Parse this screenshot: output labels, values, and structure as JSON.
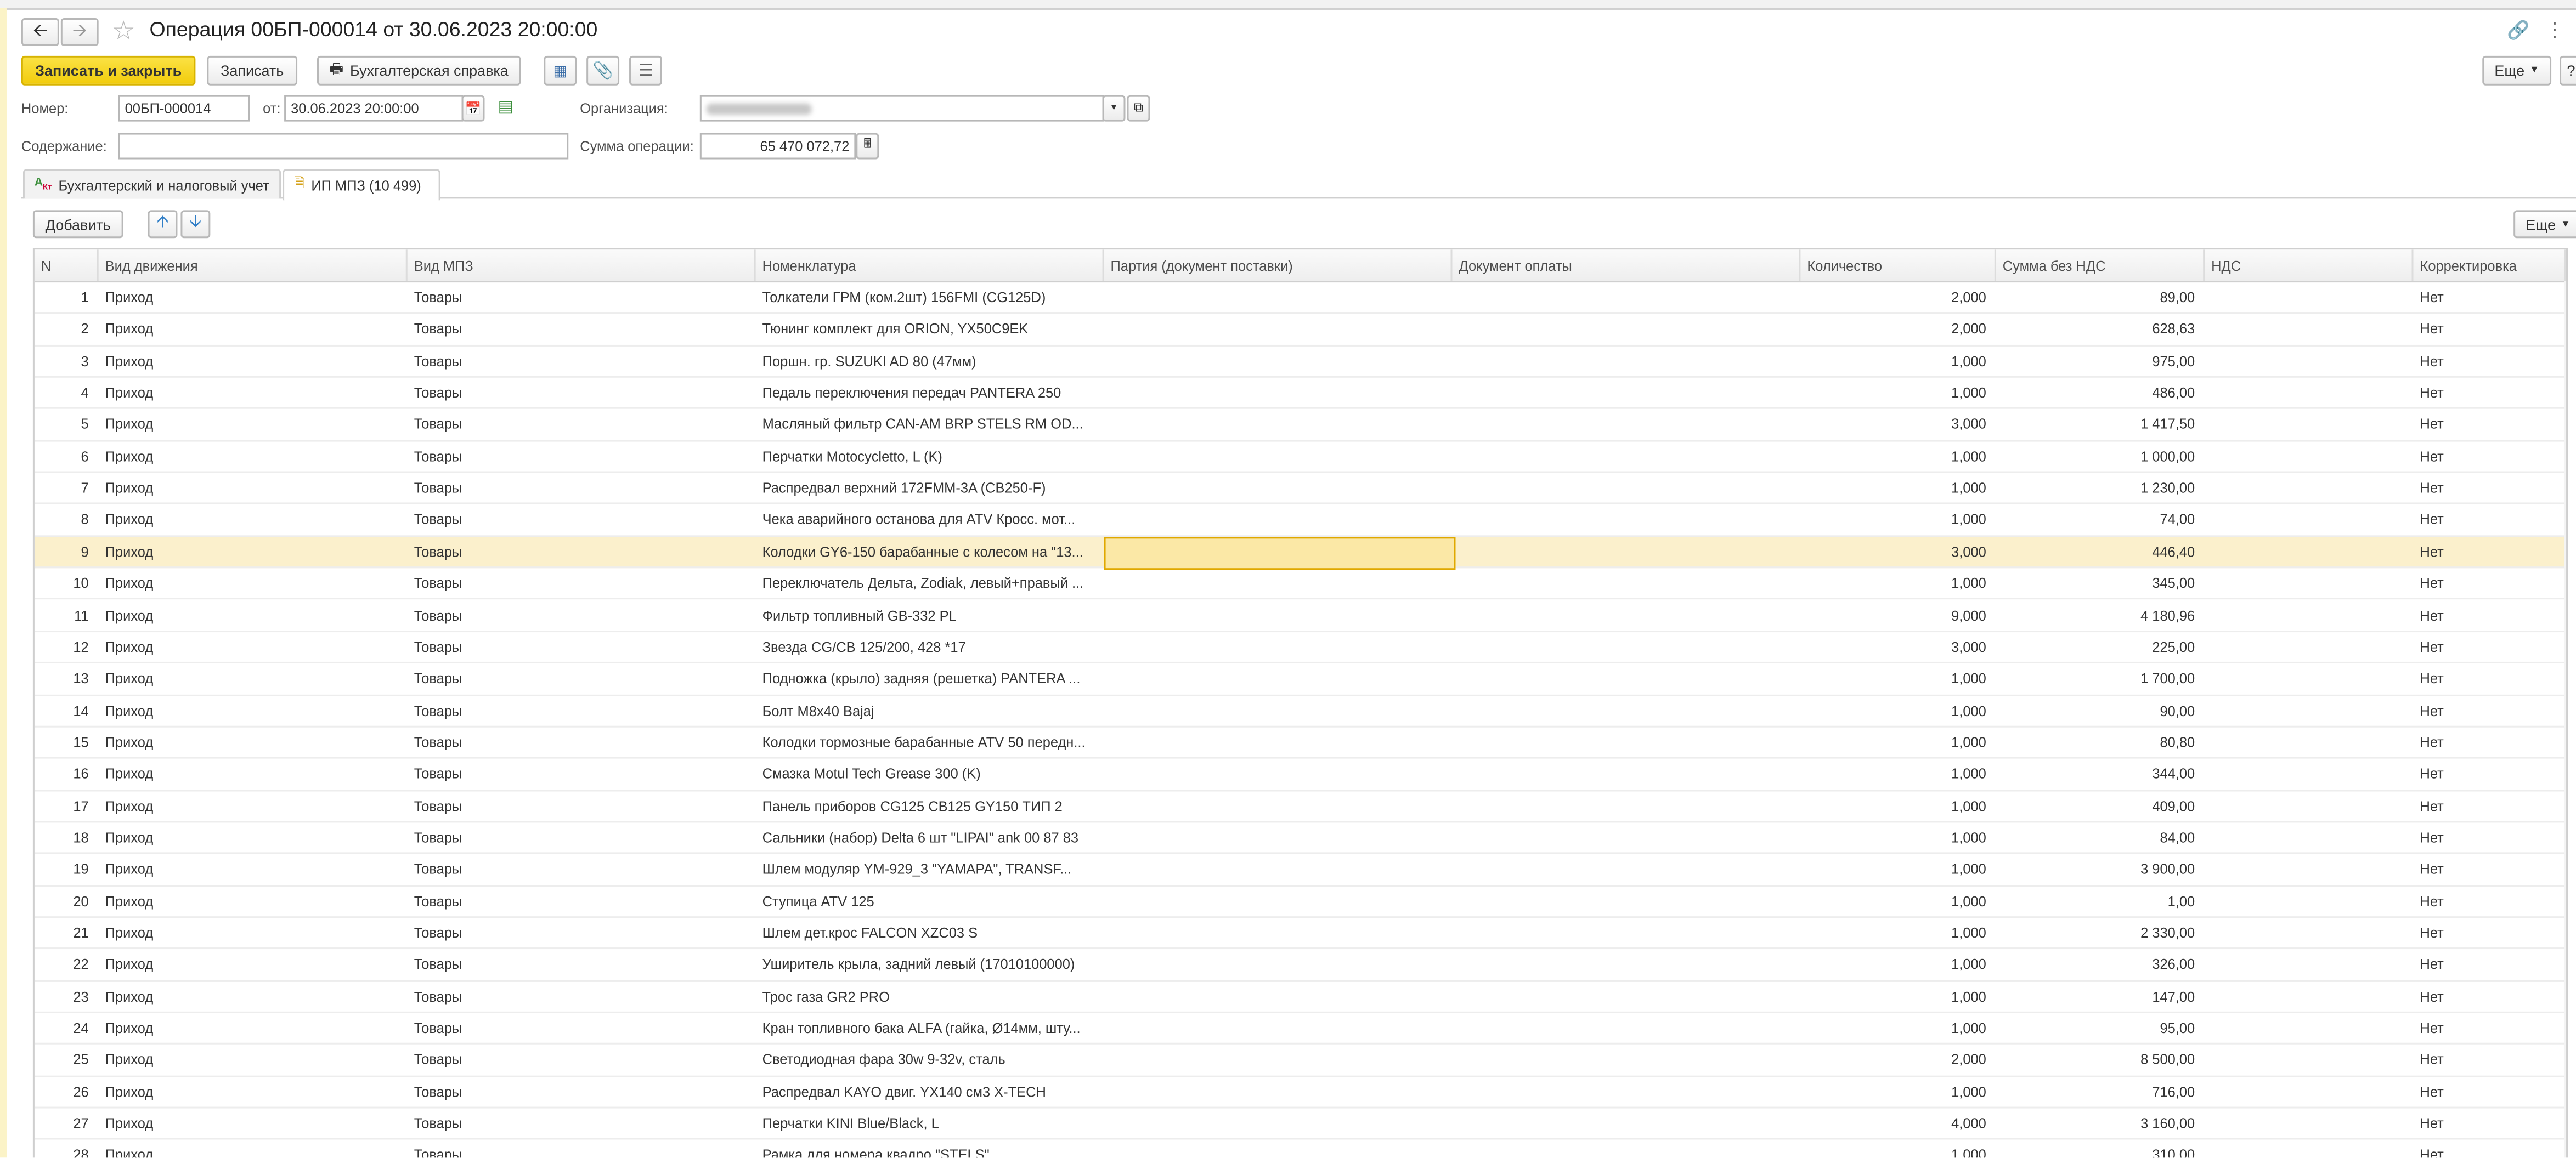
{
  "window": {
    "title": "Операция 00БП-000014 от 30.06.2023 20:00:00",
    "more_label": "Еще"
  },
  "toolbar": {
    "post_and_close_label": "Записать и закрыть",
    "save_label": "Записать",
    "accounting_report_label": "Бухгалтерская справка"
  },
  "form": {
    "number_label": "Номер:",
    "number_value": "00БП-000014",
    "date_label": "от:",
    "date_value": "30.06.2023 20:00:00",
    "organization_label": "Организация:",
    "content_label": "Содержание:",
    "content_value": "",
    "amount_label": "Сумма операции:",
    "amount_value": "65 470 072,72"
  },
  "tabs": [
    {
      "label": "Бухгалтерский и налоговый учет",
      "active": false
    },
    {
      "label": "ИП МПЗ (10 499)",
      "active": true
    }
  ],
  "table_toolbar": {
    "add_label": "Добавить",
    "more_label": "Еще"
  },
  "table": {
    "columns": [
      "N",
      "Вид движения",
      "Вид МПЗ",
      "Номенклатура",
      "Партия (документ поставки)",
      "Документ оплаты",
      "Количество",
      "Сумма без НДС",
      "НДС",
      "Корректировка"
    ],
    "selected_row": 9,
    "rows": [
      [
        "1",
        "Приход",
        "Товары",
        "Толкатели ГРМ (ком.2шт) 156FMI (CG125D)",
        "",
        "",
        "2,000",
        "89,00",
        "",
        "Нет"
      ],
      [
        "2",
        "Приход",
        "Товары",
        "Тюнинг комплект для ORION, YX50C9EK",
        "",
        "",
        "2,000",
        "628,63",
        "",
        "Нет"
      ],
      [
        "3",
        "Приход",
        "Товары",
        "Поршн. гр. SUZUKI AD 80 (47мм)",
        "",
        "",
        "1,000",
        "975,00",
        "",
        "Нет"
      ],
      [
        "4",
        "Приход",
        "Товары",
        "Педаль переключения передач PANTERA 250",
        "",
        "",
        "1,000",
        "486,00",
        "",
        "Нет"
      ],
      [
        "5",
        "Приход",
        "Товары",
        "Масляный фильтр CAN-AM BRP STELS RM OD...",
        "",
        "",
        "3,000",
        "1 417,50",
        "",
        "Нет"
      ],
      [
        "6",
        "Приход",
        "Товары",
        "Перчатки Motocycletto, L (K)",
        "",
        "",
        "1,000",
        "1 000,00",
        "",
        "Нет"
      ],
      [
        "7",
        "Приход",
        "Товары",
        "Распредвал верхний 172FMM-3A (CB250-F)",
        "",
        "",
        "1,000",
        "1 230,00",
        "",
        "Нет"
      ],
      [
        "8",
        "Приход",
        "Товары",
        "Чека аварийного останова для ATV  Кросс. мот...",
        "",
        "",
        "1,000",
        "74,00",
        "",
        "Нет"
      ],
      [
        "9",
        "Приход",
        "Товары",
        "Колодки GY6-150 барабанные с колесом на \"13...",
        "",
        "",
        "3,000",
        "446,40",
        "",
        "Нет"
      ],
      [
        "10",
        "Приход",
        "Товары",
        "Переключатель Дельта, Zodiak, левый+правый ...",
        "",
        "",
        "1,000",
        "345,00",
        "",
        "Нет"
      ],
      [
        "11",
        "Приход",
        "Товары",
        "Фильтр топливный GB-332 PL",
        "",
        "",
        "9,000",
        "4 180,96",
        "",
        "Нет"
      ],
      [
        "12",
        "Приход",
        "Товары",
        "Звезда CG/CB 125/200, 428 *17",
        "",
        "",
        "3,000",
        "225,00",
        "",
        "Нет"
      ],
      [
        "13",
        "Приход",
        "Товары",
        "Подножка (крыло) задняя (решетка) PANTERA ...",
        "",
        "",
        "1,000",
        "1 700,00",
        "",
        "Нет"
      ],
      [
        "14",
        "Приход",
        "Товары",
        "Болт M8x40 Bajaj",
        "",
        "",
        "1,000",
        "90,00",
        "",
        "Нет"
      ],
      [
        "15",
        "Приход",
        "Товары",
        "Колодки тормозные барабанные ATV 50 передн...",
        "",
        "",
        "1,000",
        "80,80",
        "",
        "Нет"
      ],
      [
        "16",
        "Приход",
        "Товары",
        "Смазка Motul Tech Grease 300 (K)",
        "",
        "",
        "1,000",
        "344,00",
        "",
        "Нет"
      ],
      [
        "17",
        "Приход",
        "Товары",
        "Панель приборов CG125  CB125  GY150 ТИП 2",
        "",
        "",
        "1,000",
        "409,00",
        "",
        "Нет"
      ],
      [
        "18",
        "Приход",
        "Товары",
        "Сальники (набор) Delta  6 шт  \"LIPAI\" ank 00 87 83",
        "",
        "",
        "1,000",
        "84,00",
        "",
        "Нет"
      ],
      [
        "19",
        "Приход",
        "Товары",
        "Шлем модуляр YM-929_3 \"YAMAPA\", TRANSF...",
        "",
        "",
        "1,000",
        "3 900,00",
        "",
        "Нет"
      ],
      [
        "20",
        "Приход",
        "Товары",
        "Ступица ATV 125",
        "",
        "",
        "1,000",
        "1,00",
        "",
        "Нет"
      ],
      [
        "21",
        "Приход",
        "Товары",
        "Шлем дет.крос FALCON XZC03 S",
        "",
        "",
        "1,000",
        "2 330,00",
        "",
        "Нет"
      ],
      [
        "22",
        "Приход",
        "Товары",
        "Уширитель крыла, задний левый (17010100000)",
        "",
        "",
        "1,000",
        "326,00",
        "",
        "Нет"
      ],
      [
        "23",
        "Приход",
        "Товары",
        "Трос газа GR2 PRO",
        "",
        "",
        "1,000",
        "147,00",
        "",
        "Нет"
      ],
      [
        "24",
        "Приход",
        "Товары",
        "Кран топливного бака ALFA (гайка, Ø14мм, шту...",
        "",
        "",
        "1,000",
        "95,00",
        "",
        "Нет"
      ],
      [
        "25",
        "Приход",
        "Товары",
        "Светодиодная фара 30w 9-32v, сталь",
        "",
        "",
        "2,000",
        "8 500,00",
        "",
        "Нет"
      ],
      [
        "26",
        "Приход",
        "Товары",
        "Распредвал KAYO двиг. YX140 см3 X-TECH",
        "",
        "",
        "1,000",
        "716,00",
        "",
        "Нет"
      ],
      [
        "27",
        "Приход",
        "Товары",
        "Перчатки KINI Blue/Black, L",
        "",
        "",
        "4,000",
        "3 160,00",
        "",
        "Нет"
      ],
      [
        "28",
        "Приход",
        "Товары",
        "Рамка для номера квадро \"STELS\"",
        "",
        "",
        "1,000",
        "310,00",
        "",
        "Нет"
      ]
    ]
  },
  "colors": {
    "primary_button": "#f5d515",
    "selected_row": "#fbf0cc",
    "selected_cell_border": "#e0a800"
  }
}
